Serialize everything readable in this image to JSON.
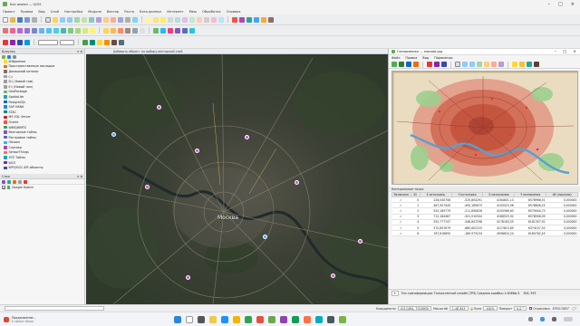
{
  "window": {
    "title": "Без имени — QGIS"
  },
  "menubar": [
    "Проект",
    "Правка",
    "Вид",
    "Слой",
    "Настройки",
    "Модули",
    "Вектор",
    "Растр",
    "База данных",
    "Интернет",
    "Меш",
    "Обработка",
    "Справка"
  ],
  "browser": {
    "title": "Браузер",
    "items": [
      "Избранное",
      "Пространственные закладки",
      "Домашний каталог",
      "C:\\",
      "D:\\ (Новый том)",
      "E:\\ (Новый том)",
      "GeoPackage",
      "SpatiaLite",
      "PostgreSQL",
      "SAP HANA",
      "STAC",
      "MS SQL Server",
      "Oracle",
      "WMS/WMTS",
      "Векторные тайлы",
      "Растровые тайлы",
      "Obvoex",
      "Слогики",
      "SensorThings",
      "XYZ Тайлы",
      "WCS",
      "WFS/OGC API объекты"
    ]
  },
  "layers": {
    "title": "Слои",
    "items": [
      {
        "name": "Google Hybrid",
        "checked": true
      }
    ]
  },
  "map": {
    "message": "Добавить объект: по выбору векторный слой",
    "city_label": "Москва"
  },
  "georef": {
    "title": "Геопривязка — москва.jpg",
    "menu": [
      "Файл",
      "Правка",
      "Вид",
      "Параметры"
    ],
    "gcp_title": "Контрольные точки",
    "columns": [
      "Включено",
      "ID",
      "X источника",
      "Y источника",
      "X назначения",
      "Y назначения",
      "dX (пиксели)"
    ],
    "rows": [
      [
        "0",
        "226,040708",
        "-525,804291",
        "4164801,13",
        "6578966,51",
        "0,000000"
      ],
      [
        "1",
        "487,907440",
        "-495,189675",
        "4150023,96",
        "6578806,25",
        "0,000000"
      ],
      [
        "2",
        "520,169779",
        "-211,890626",
        "4150566,63",
        "6579044,75",
        "0,000000"
      ],
      [
        "3",
        "712,184487",
        "-501,910504",
        "4168525,92",
        "6578906,09",
        "0,000000"
      ],
      [
        "4",
        "292,777747",
        "-346,847298",
        "4178163,55",
        "6181357,92",
        "0,000000"
      ],
      [
        "5",
        "570,857679",
        "-880,602225",
        "4127815,89",
        "6374107,55",
        "0,000000"
      ],
      [
        "6",
        "767,616690",
        "-189,973234",
        "4098620,24",
        "6165782,45",
        "0,000000"
      ]
    ],
    "status": "Тип трансформации: Тонкостенный сплайн (TPS) Средняя ошибка: 4.8368м 0.",
    "status_extra": "306, 593"
  },
  "statusbar": {
    "coord_label": "Координаты",
    "coord_value": "4212484, 7518955",
    "scale_label": "Масштаб",
    "scale_value": "1:48 843",
    "magnifier_label": "Лупа",
    "magnifier_value": "100%",
    "rotation_label": "Поворот",
    "rotation_value": "0,0 °",
    "render_label": "Отрисовка",
    "crs": "EPSG:3857"
  },
  "taskbar": {
    "notif_title": "Продолжение...",
    "notif_sub": "в сфере сбора"
  },
  "colors": {
    "map_dark": "#2e3229",
    "map_green": "#3d4a33",
    "old_map_red": "#d2705a",
    "old_map_bg": "#e9dcc0"
  }
}
